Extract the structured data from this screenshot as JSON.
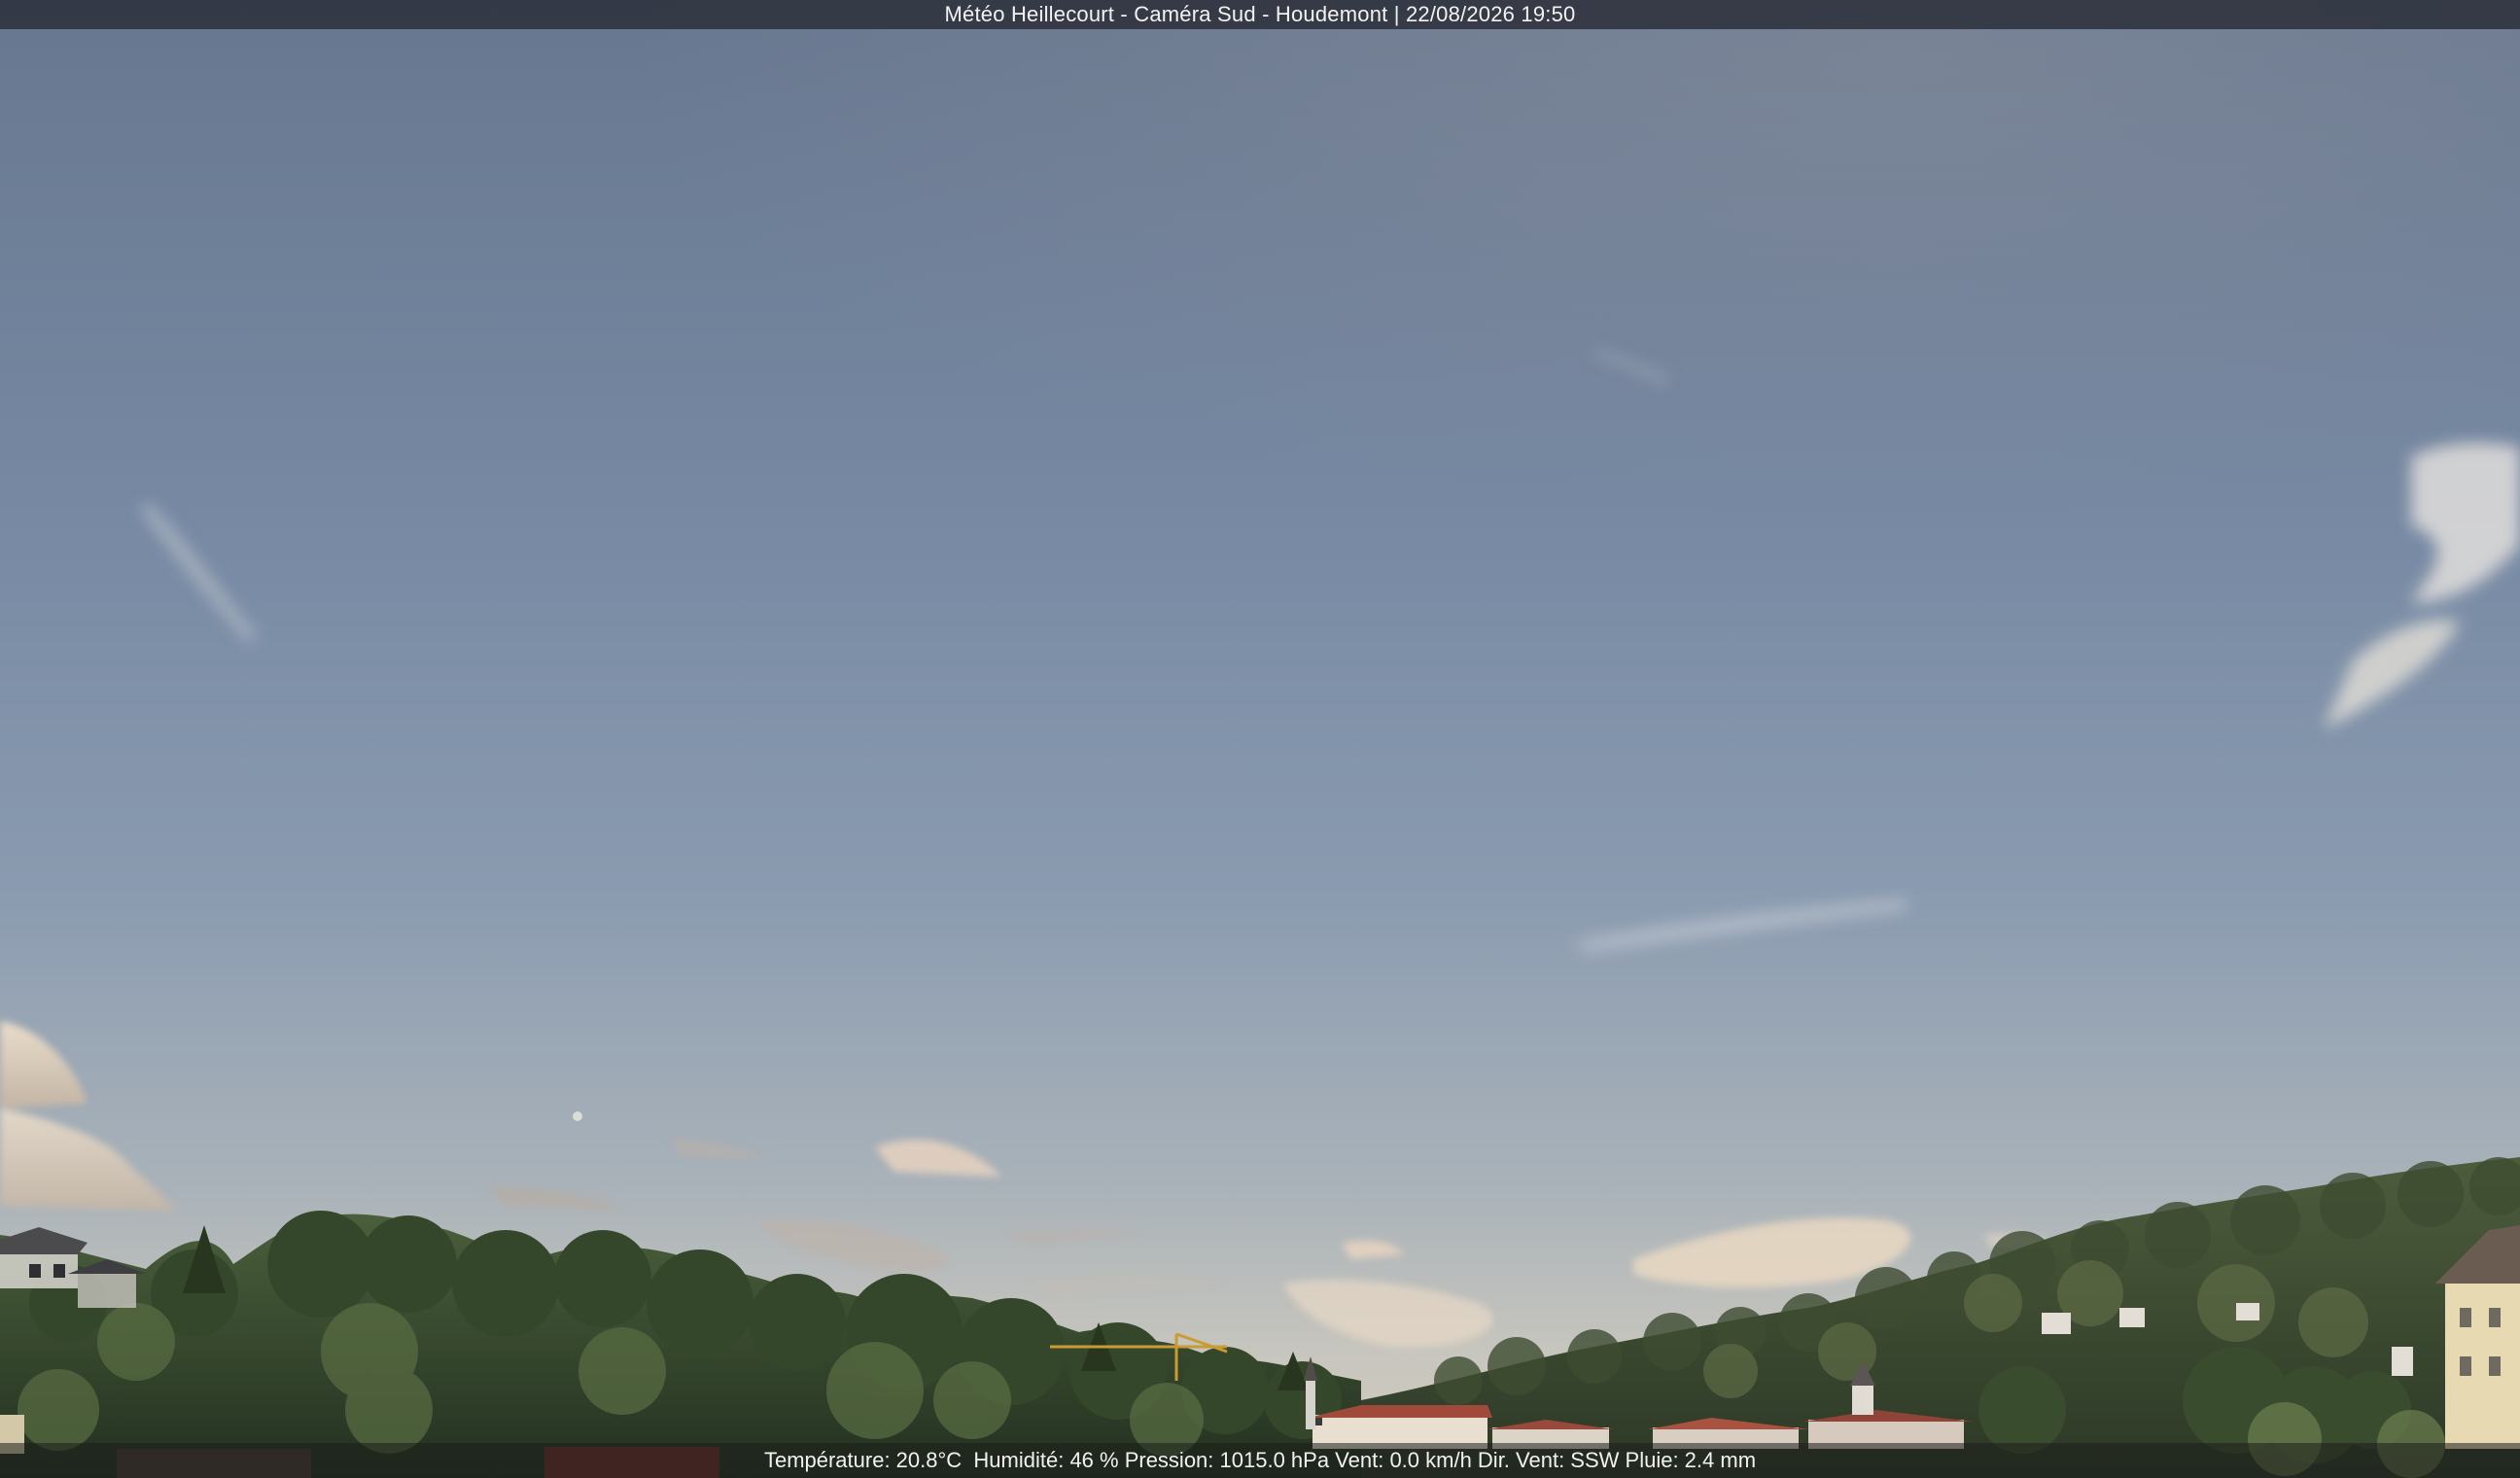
{
  "header": {
    "title": "Météo Heillecourt - Caméra Sud - Houdemont | 22/08/2026 19:50"
  },
  "footer": {
    "readings": "Température: 20.8°C  Humidité: 46 % Pression: 1015.0 hPa Vent: 0.0 km/h Dir. Vent: SSW Pluie: 2.4 mm"
  },
  "colors": {
    "sky_top": "#6a7a93",
    "sky_mid": "#8596ad",
    "sky_horizon": "#c9c6bd",
    "vegetation": "#3c5232",
    "overlay": "#282c36",
    "text": "#f2f2f2"
  }
}
